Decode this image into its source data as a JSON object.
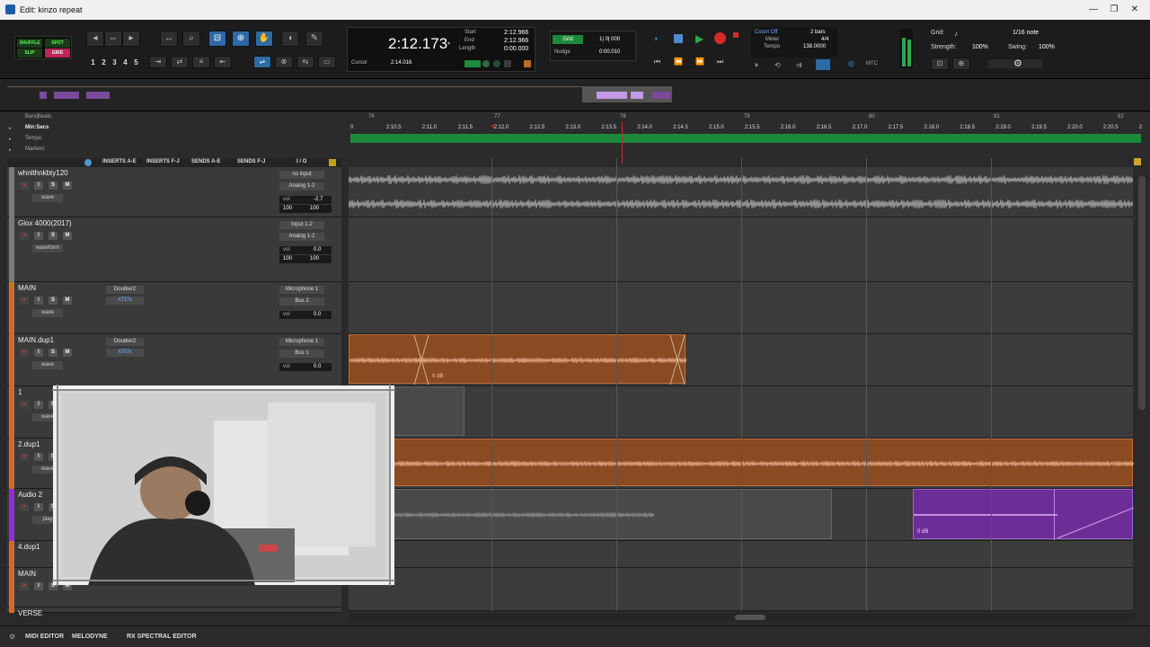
{
  "window": {
    "title": "Edit: kinzo repeat",
    "controls": [
      "—",
      "❐",
      "✕"
    ]
  },
  "modes": {
    "shuffle": "SHUFFLE",
    "spot": "SPOT",
    "slip": "SLIP",
    "grid": "GRID"
  },
  "zoom_presets": [
    "1",
    "2",
    "3",
    "4",
    "5"
  ],
  "counter": {
    "main": "2:12.173",
    "start_label": "Start",
    "start": "2:12.966",
    "end_label": "End",
    "end": "2:12.966",
    "length_label": "Length",
    "length": "0:00.000",
    "cursor_label": "Cursor",
    "cursor": "2:14.016"
  },
  "grid_nudge": {
    "grid_btn": "Grid",
    "grid_value": "1| 0| 000",
    "nudge_label": "Nudge",
    "nudge_value": "0:00.010"
  },
  "transport": {
    "count_off": "Count Off",
    "meter_label": "Meter",
    "tempo_label": "Tempo",
    "bars": "2 bars",
    "meter": "4/4",
    "tempo": "138.0000"
  },
  "grid_settings": {
    "grid_label": "Grid:",
    "grid_value": "1/16 note",
    "strength_label": "Strength:",
    "strength": "100%",
    "swing_label": "Swing:",
    "swing": "100%"
  },
  "rulers": [
    "Bars|Beats",
    "Min:Secs",
    "Tempo",
    "Markers"
  ],
  "bars_ticks": [
    "76",
    "77",
    "78",
    "79",
    "80",
    "81",
    "82"
  ],
  "min_ticks": [
    "0",
    "2:10.5",
    "2:11.0",
    "2:11.5",
    "2:12.0",
    "2:12.5",
    "2:13.0",
    "2:13.5",
    "2:14.0",
    "2:14.5",
    "2:15.0",
    "2:15.5",
    "2:16.0",
    "2:16.5",
    "2:17.0",
    "2:17.5",
    "2:18.0",
    "2:18.5",
    "2:19.0",
    "2:19.5",
    "2:20.0",
    "2:20.5",
    "2"
  ],
  "mix_columns": [
    "INSERTS A-E",
    "INSERTS F-J",
    "SENDS A-E",
    "SENDS F-J",
    "I / O"
  ],
  "tracks": [
    {
      "name": "whnlthnkbty120",
      "io_in": "no input",
      "io_out": "Analog 1-2",
      "vol": "-2.7",
      "pan_l": "100",
      "pan_r": "100",
      "view": "wave",
      "color": "#7a7a7a",
      "insert": "",
      "insert2": ""
    },
    {
      "name": "Glox 4000(2017)",
      "io_in": "Input 1-2",
      "io_out": "Analog 1-2",
      "vol": "0.0",
      "pan_l": "100",
      "pan_r": "100",
      "view": "waveform",
      "color": "#7a7a7a",
      "insert": "",
      "insert2": ""
    },
    {
      "name": "MAIN",
      "io_in": "Microphone 1",
      "io_out": "Bus 2",
      "vol": "0.0",
      "view": "wave",
      "color": "#d46a2a",
      "insert": "Doubler2",
      "insert2": "ATEfx"
    },
    {
      "name": "MAIN.dup1",
      "io_in": "Microphone 1",
      "io_out": "Bus 1",
      "vol": "0.0",
      "view": "wave",
      "color": "#d46a2a",
      "insert": "Doubler2",
      "insert2": "ATEfx"
    },
    {
      "name": "1",
      "view": "wave",
      "color": "#d46a2a"
    },
    {
      "name": "2.dup1",
      "view": "wave",
      "color": "#d46a2a"
    },
    {
      "name": "Audio 2",
      "view": "play",
      "color": "#9a2ad4"
    },
    {
      "name": "4.dup1",
      "color": "#d46a2a"
    },
    {
      "name": "MAIN",
      "color": "#d46a2a"
    },
    {
      "name": "VERSE",
      "color": "#d46a2a"
    }
  ],
  "clips": {
    "main_dup1_gain": "0 dB",
    "audio2_gain": "0 dB"
  },
  "bottom_tabs": [
    "MIDI EDITOR",
    "MELODYNE",
    "RX SPECTRAL EDITOR"
  ],
  "colors": {
    "orange_clip": "#8a4a22",
    "purple_clip": "#6d2d96",
    "playhead": "#d02a2a",
    "accent_blue": "#2d6aa6",
    "timeline_green": "#1c8a3a"
  }
}
